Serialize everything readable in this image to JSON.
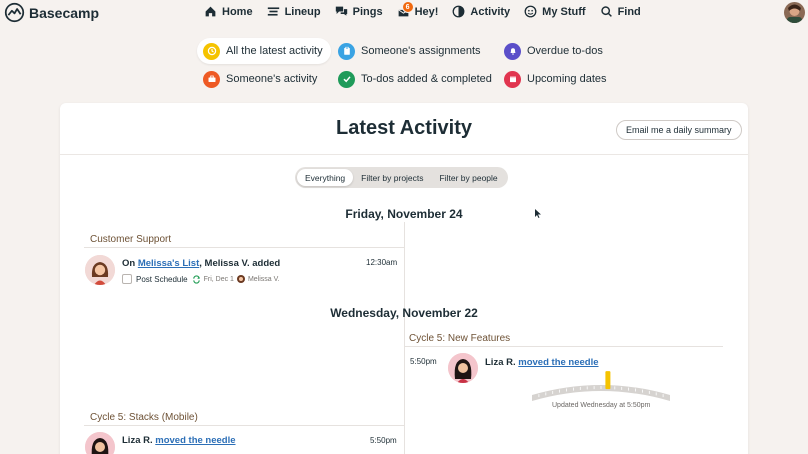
{
  "brand": {
    "name": "Basecamp"
  },
  "nav": {
    "items": [
      {
        "label": "Home",
        "icon": "home-icon"
      },
      {
        "label": "Lineup",
        "icon": "lineup-icon"
      },
      {
        "label": "Pings",
        "icon": "pings-icon"
      },
      {
        "label": "Hey!",
        "icon": "hey-icon",
        "badge": "6"
      },
      {
        "label": "Activity",
        "icon": "activity-icon"
      },
      {
        "label": "My Stuff",
        "icon": "my-stuff-icon"
      },
      {
        "label": "Find",
        "icon": "search-icon"
      }
    ]
  },
  "shortcuts": {
    "latest": "All the latest activity",
    "someones_activity": "Someone's activity",
    "assignments": "Someone's assignments",
    "todos_added": "To-dos added & completed",
    "overdue": "Overdue to-dos",
    "upcoming": "Upcoming dates"
  },
  "page": {
    "title": "Latest Activity",
    "email_button": "Email me a daily summary",
    "filters": [
      "Everything",
      "Filter by projects",
      "Filter by people"
    ],
    "active_filter": "Everything"
  },
  "days": {
    "fri": "Friday, November 24",
    "wed": "Wednesday, November 22"
  },
  "activities": {
    "a1": {
      "project": "Customer Support",
      "prefix": "On ",
      "link": "Melissa's List",
      "suffix": ", Melissa V. added",
      "time": "12:30am",
      "todo": "Post Schedule",
      "due": "Fri, Dec 1",
      "assignee": "Melissa V."
    },
    "a2": {
      "project": "Cycle 5: New Features",
      "person": "Liza R.",
      "link": "moved the needle",
      "time": "5:50pm",
      "caption": "Updated Wednesday at 5:50pm",
      "hill_progress": 0.55
    },
    "a3": {
      "project": "Cycle 5: Stacks (Mobile)",
      "person": "Liza R.",
      "link": "moved the needle",
      "time": "5:50pm"
    }
  },
  "colors": {
    "background": "#f6f2ef",
    "link": "#2c6fb7",
    "hey_badge": "#f1690f",
    "latest_icon": "#f5c300",
    "someone_icon": "#ee5a24",
    "assignments_icon": "#3aa3e3",
    "todos_icon": "#1f9b5a",
    "overdue_icon": "#5b4fc9",
    "upcoming_icon": "#e1354f"
  }
}
